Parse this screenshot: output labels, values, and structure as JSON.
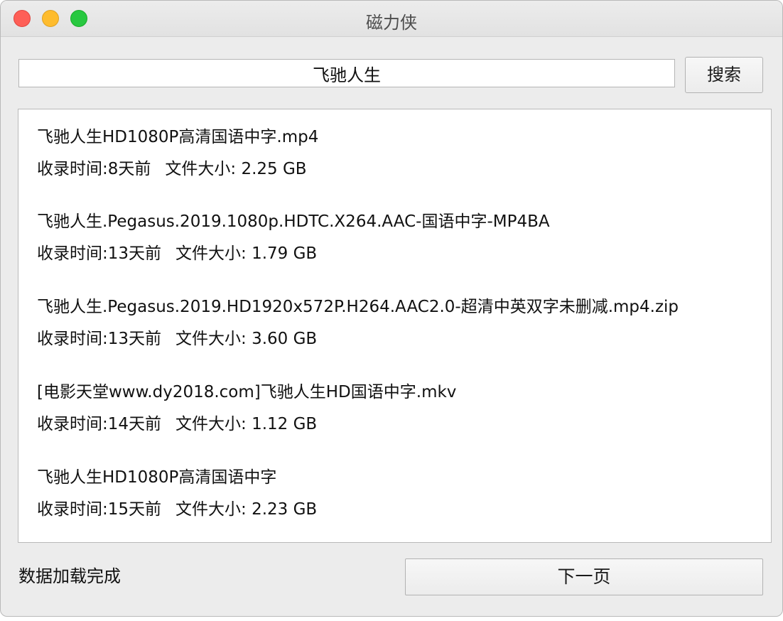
{
  "window": {
    "title": "磁力侠"
  },
  "search": {
    "value": "飞驰人生",
    "button_label": "搜索"
  },
  "results": [
    {
      "name": "飞驰人生HD1080P高清国语中字.mp4",
      "time": "收录时间:8天前",
      "size": "文件大小: 2.25 GB"
    },
    {
      "name": "飞驰人生.Pegasus.2019.1080p.HDTC.X264.AAC-国语中字-MP4BA",
      "time": "收录时间:13天前",
      "size": "文件大小: 1.79 GB"
    },
    {
      "name": "飞驰人生.Pegasus.2019.HD1920x572P.H264.AAC2.0-超清中英双字未删减.mp4.zip",
      "time": "收录时间:13天前",
      "size": "文件大小: 3.60 GB"
    },
    {
      "name": "[电影天堂www.dy2018.com]飞驰人生HD国语中字.mkv",
      "time": "收录时间:14天前",
      "size": "文件大小: 1.12 GB"
    },
    {
      "name": "飞驰人生HD1080P高清国语中字",
      "time": "收录时间:15天前",
      "size": "文件大小: 2.23 GB"
    }
  ],
  "status": {
    "text": "数据加载完成"
  },
  "pagination": {
    "next_label": "下一页"
  },
  "colors": {
    "close": "#fe5f57",
    "minimize": "#febc2e",
    "zoom": "#28c840"
  },
  "icons": {
    "close": "close-icon",
    "minimize": "minimize-icon",
    "zoom": "zoom-icon"
  }
}
